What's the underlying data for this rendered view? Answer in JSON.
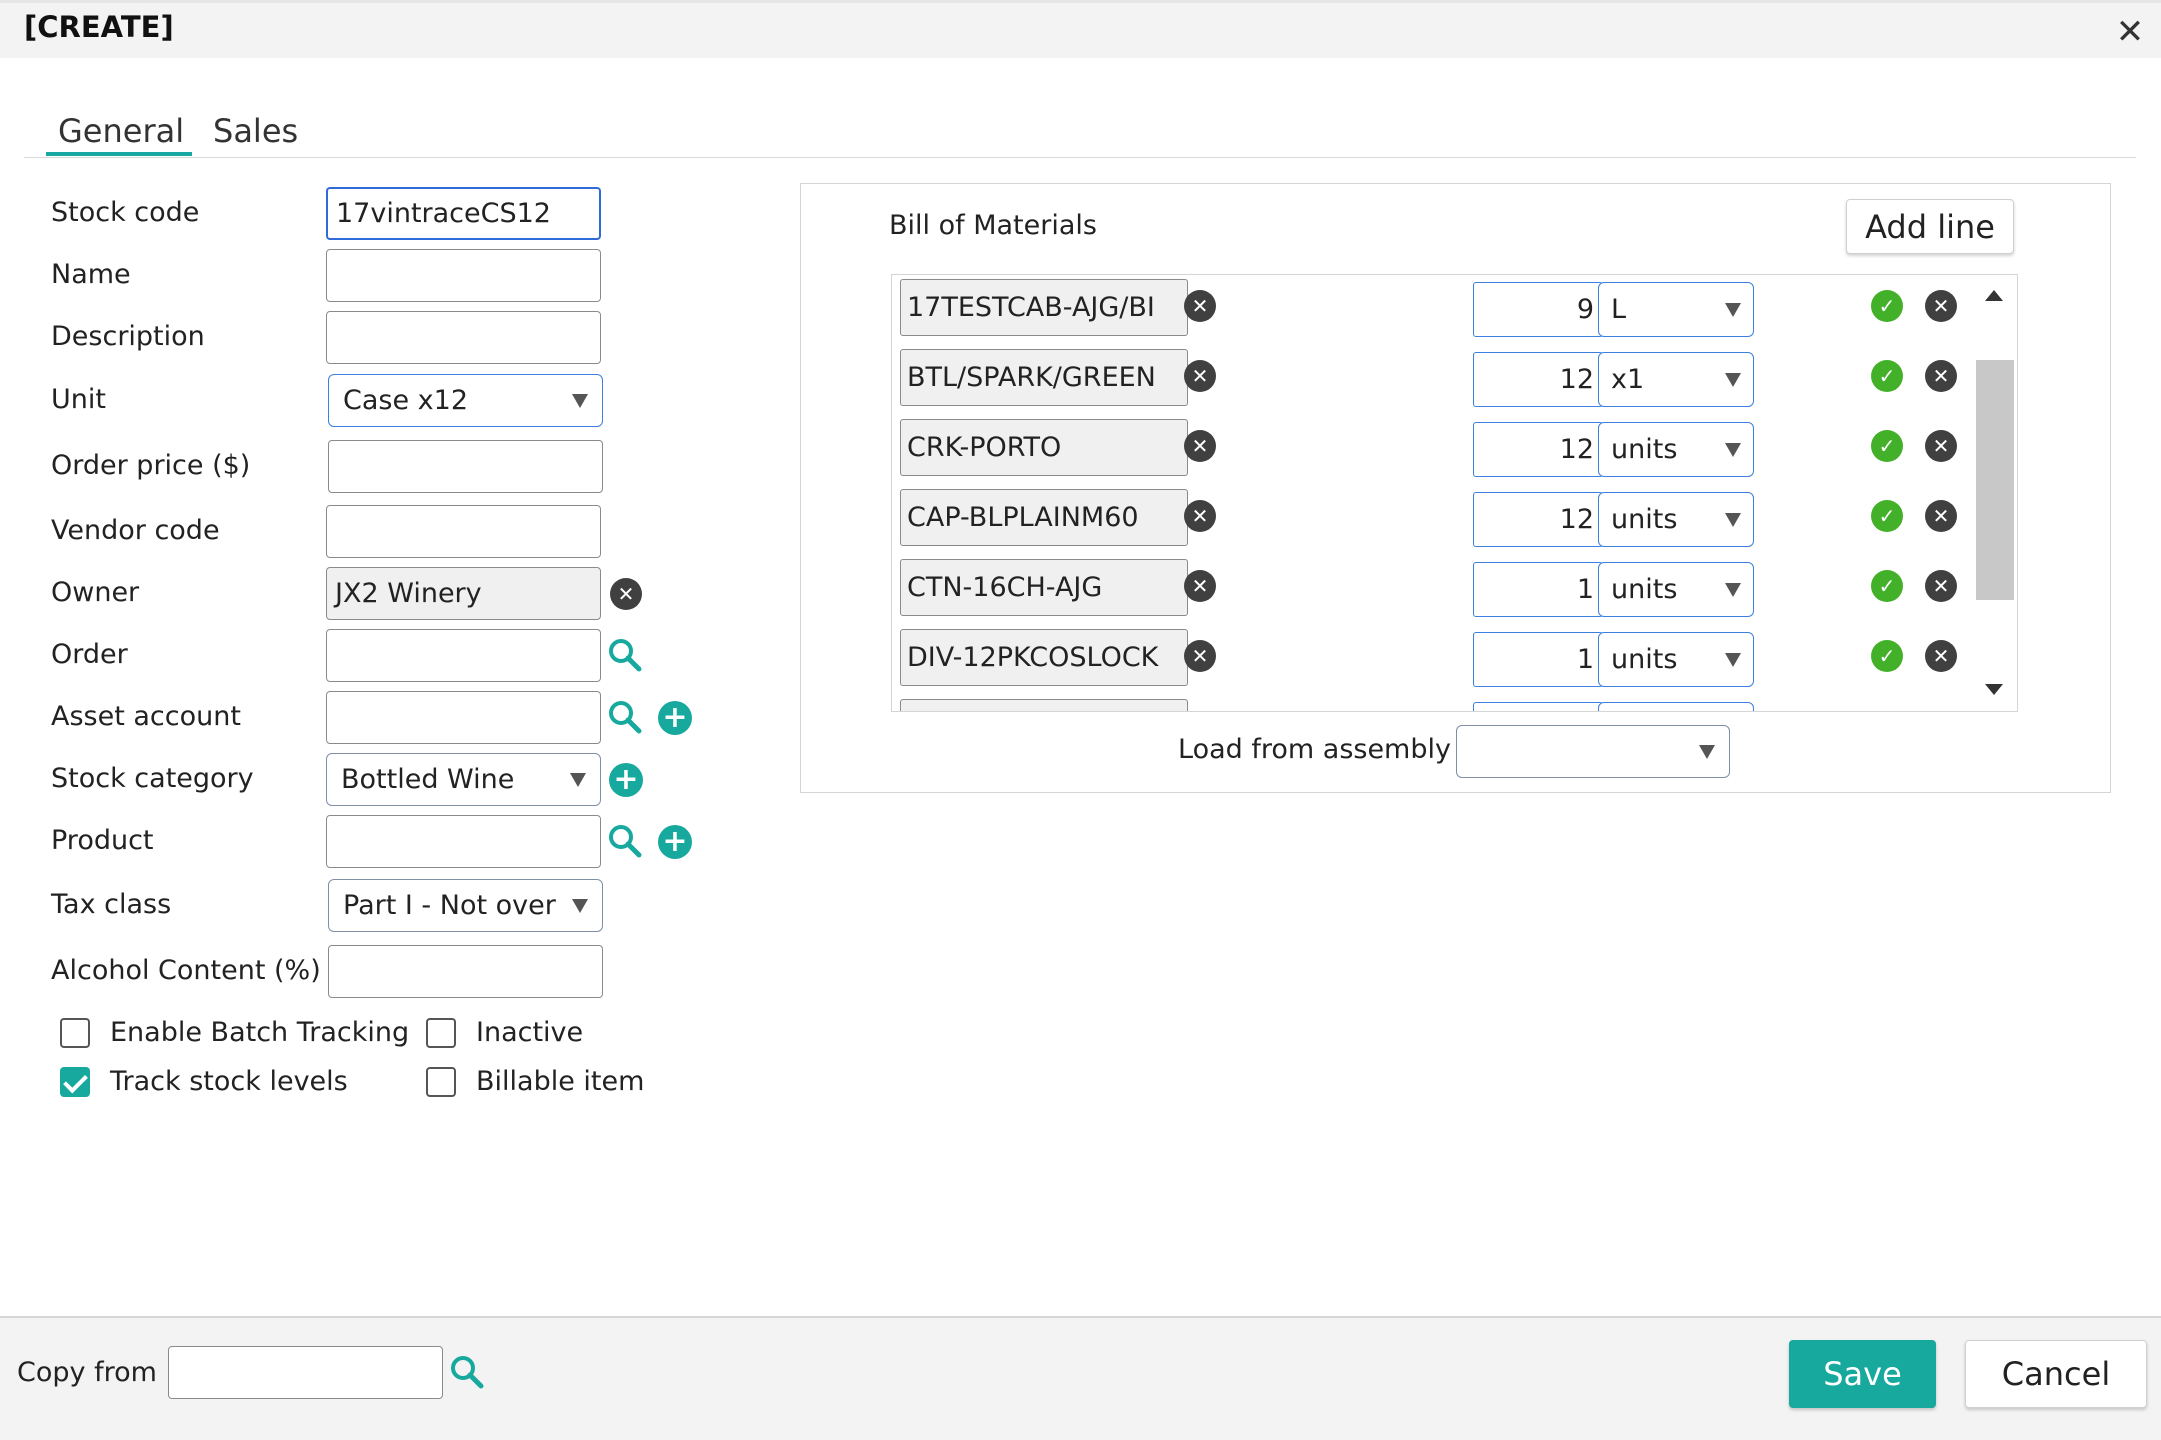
{
  "dialog": {
    "title": "[CREATE]",
    "close_icon": "close-icon"
  },
  "tabs": [
    {
      "label": "General",
      "active": true
    },
    {
      "label": "Sales",
      "active": false
    }
  ],
  "form": {
    "stock_code": {
      "label": "Stock code",
      "value": "17vintraceCS12"
    },
    "name": {
      "label": "Name",
      "value": ""
    },
    "description": {
      "label": "Description",
      "value": ""
    },
    "unit": {
      "label": "Unit",
      "value": "Case x12"
    },
    "order_price": {
      "label": "Order price ($)",
      "value": ""
    },
    "vendor_code": {
      "label": "Vendor code",
      "value": ""
    },
    "owner": {
      "label": "Owner",
      "value": "JX2 Winery"
    },
    "order": {
      "label": "Order",
      "value": ""
    },
    "asset_account": {
      "label": "Asset account",
      "value": ""
    },
    "stock_category": {
      "label": "Stock category",
      "value": "Bottled Wine"
    },
    "product": {
      "label": "Product",
      "value": ""
    },
    "tax_class": {
      "label": "Tax class",
      "value": "Part I - Not over"
    },
    "alcohol_content": {
      "label": "Alcohol Content (%)",
      "value": ""
    }
  },
  "checkboxes": {
    "enable_batch_tracking": {
      "label": "Enable Batch Tracking",
      "checked": false
    },
    "inactive": {
      "label": "Inactive",
      "checked": false
    },
    "track_stock_levels": {
      "label": "Track stock levels",
      "checked": true
    },
    "billable_item": {
      "label": "Billable item",
      "checked": false
    }
  },
  "bom": {
    "title": "Bill of Materials",
    "add_line_label": "Add line",
    "rows": [
      {
        "code": "17TESTCAB-AJG/BI",
        "qty": "9",
        "unit": "L"
      },
      {
        "code": "BTL/SPARK/GREEN",
        "qty": "12",
        "unit": "x1"
      },
      {
        "code": "CRK-PORTO",
        "qty": "12",
        "unit": "units"
      },
      {
        "code": "CAP-BLPLAINM60",
        "qty": "12",
        "unit": "units"
      },
      {
        "code": "CTN-16CH-AJG",
        "qty": "1",
        "unit": "units"
      },
      {
        "code": "DIV-12PKCOSLOCK",
        "qty": "1",
        "unit": "units"
      }
    ],
    "load_from_assembly_label": "Load from assembly",
    "load_from_assembly_value": ""
  },
  "footer": {
    "copy_from_label": "Copy from",
    "copy_from_value": "",
    "save_label": "Save",
    "cancel_label": "Cancel"
  },
  "colors": {
    "accent": "#17a99e",
    "focus_border": "#2f6bd9",
    "ok_green": "#43b02a"
  }
}
